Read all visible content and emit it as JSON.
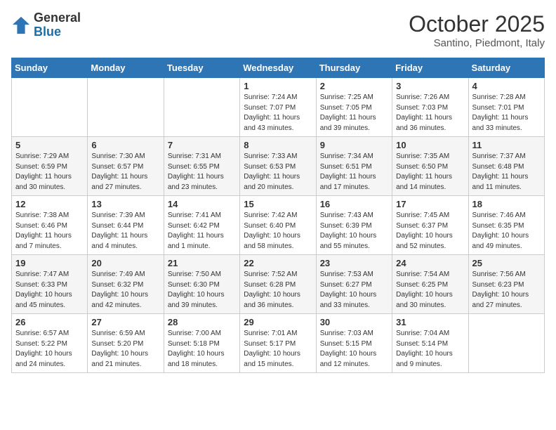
{
  "header": {
    "logo": {
      "line1": "General",
      "line2": "Blue"
    },
    "title": "October 2025",
    "subtitle": "Santino, Piedmont, Italy"
  },
  "weekdays": [
    "Sunday",
    "Monday",
    "Tuesday",
    "Wednesday",
    "Thursday",
    "Friday",
    "Saturday"
  ],
  "weeks": [
    [
      {
        "day": "",
        "info": ""
      },
      {
        "day": "",
        "info": ""
      },
      {
        "day": "",
        "info": ""
      },
      {
        "day": "1",
        "info": "Sunrise: 7:24 AM\nSunset: 7:07 PM\nDaylight: 11 hours\nand 43 minutes."
      },
      {
        "day": "2",
        "info": "Sunrise: 7:25 AM\nSunset: 7:05 PM\nDaylight: 11 hours\nand 39 minutes."
      },
      {
        "day": "3",
        "info": "Sunrise: 7:26 AM\nSunset: 7:03 PM\nDaylight: 11 hours\nand 36 minutes."
      },
      {
        "day": "4",
        "info": "Sunrise: 7:28 AM\nSunset: 7:01 PM\nDaylight: 11 hours\nand 33 minutes."
      }
    ],
    [
      {
        "day": "5",
        "info": "Sunrise: 7:29 AM\nSunset: 6:59 PM\nDaylight: 11 hours\nand 30 minutes."
      },
      {
        "day": "6",
        "info": "Sunrise: 7:30 AM\nSunset: 6:57 PM\nDaylight: 11 hours\nand 27 minutes."
      },
      {
        "day": "7",
        "info": "Sunrise: 7:31 AM\nSunset: 6:55 PM\nDaylight: 11 hours\nand 23 minutes."
      },
      {
        "day": "8",
        "info": "Sunrise: 7:33 AM\nSunset: 6:53 PM\nDaylight: 11 hours\nand 20 minutes."
      },
      {
        "day": "9",
        "info": "Sunrise: 7:34 AM\nSunset: 6:51 PM\nDaylight: 11 hours\nand 17 minutes."
      },
      {
        "day": "10",
        "info": "Sunrise: 7:35 AM\nSunset: 6:50 PM\nDaylight: 11 hours\nand 14 minutes."
      },
      {
        "day": "11",
        "info": "Sunrise: 7:37 AM\nSunset: 6:48 PM\nDaylight: 11 hours\nand 11 minutes."
      }
    ],
    [
      {
        "day": "12",
        "info": "Sunrise: 7:38 AM\nSunset: 6:46 PM\nDaylight: 11 hours\nand 7 minutes."
      },
      {
        "day": "13",
        "info": "Sunrise: 7:39 AM\nSunset: 6:44 PM\nDaylight: 11 hours\nand 4 minutes."
      },
      {
        "day": "14",
        "info": "Sunrise: 7:41 AM\nSunset: 6:42 PM\nDaylight: 11 hours\nand 1 minute."
      },
      {
        "day": "15",
        "info": "Sunrise: 7:42 AM\nSunset: 6:40 PM\nDaylight: 10 hours\nand 58 minutes."
      },
      {
        "day": "16",
        "info": "Sunrise: 7:43 AM\nSunset: 6:39 PM\nDaylight: 10 hours\nand 55 minutes."
      },
      {
        "day": "17",
        "info": "Sunrise: 7:45 AM\nSunset: 6:37 PM\nDaylight: 10 hours\nand 52 minutes."
      },
      {
        "day": "18",
        "info": "Sunrise: 7:46 AM\nSunset: 6:35 PM\nDaylight: 10 hours\nand 49 minutes."
      }
    ],
    [
      {
        "day": "19",
        "info": "Sunrise: 7:47 AM\nSunset: 6:33 PM\nDaylight: 10 hours\nand 45 minutes."
      },
      {
        "day": "20",
        "info": "Sunrise: 7:49 AM\nSunset: 6:32 PM\nDaylight: 10 hours\nand 42 minutes."
      },
      {
        "day": "21",
        "info": "Sunrise: 7:50 AM\nSunset: 6:30 PM\nDaylight: 10 hours\nand 39 minutes."
      },
      {
        "day": "22",
        "info": "Sunrise: 7:52 AM\nSunset: 6:28 PM\nDaylight: 10 hours\nand 36 minutes."
      },
      {
        "day": "23",
        "info": "Sunrise: 7:53 AM\nSunset: 6:27 PM\nDaylight: 10 hours\nand 33 minutes."
      },
      {
        "day": "24",
        "info": "Sunrise: 7:54 AM\nSunset: 6:25 PM\nDaylight: 10 hours\nand 30 minutes."
      },
      {
        "day": "25",
        "info": "Sunrise: 7:56 AM\nSunset: 6:23 PM\nDaylight: 10 hours\nand 27 minutes."
      }
    ],
    [
      {
        "day": "26",
        "info": "Sunrise: 6:57 AM\nSunset: 5:22 PM\nDaylight: 10 hours\nand 24 minutes."
      },
      {
        "day": "27",
        "info": "Sunrise: 6:59 AM\nSunset: 5:20 PM\nDaylight: 10 hours\nand 21 minutes."
      },
      {
        "day": "28",
        "info": "Sunrise: 7:00 AM\nSunset: 5:18 PM\nDaylight: 10 hours\nand 18 minutes."
      },
      {
        "day": "29",
        "info": "Sunrise: 7:01 AM\nSunset: 5:17 PM\nDaylight: 10 hours\nand 15 minutes."
      },
      {
        "day": "30",
        "info": "Sunrise: 7:03 AM\nSunset: 5:15 PM\nDaylight: 10 hours\nand 12 minutes."
      },
      {
        "day": "31",
        "info": "Sunrise: 7:04 AM\nSunset: 5:14 PM\nDaylight: 10 hours\nand 9 minutes."
      },
      {
        "day": "",
        "info": ""
      }
    ]
  ]
}
